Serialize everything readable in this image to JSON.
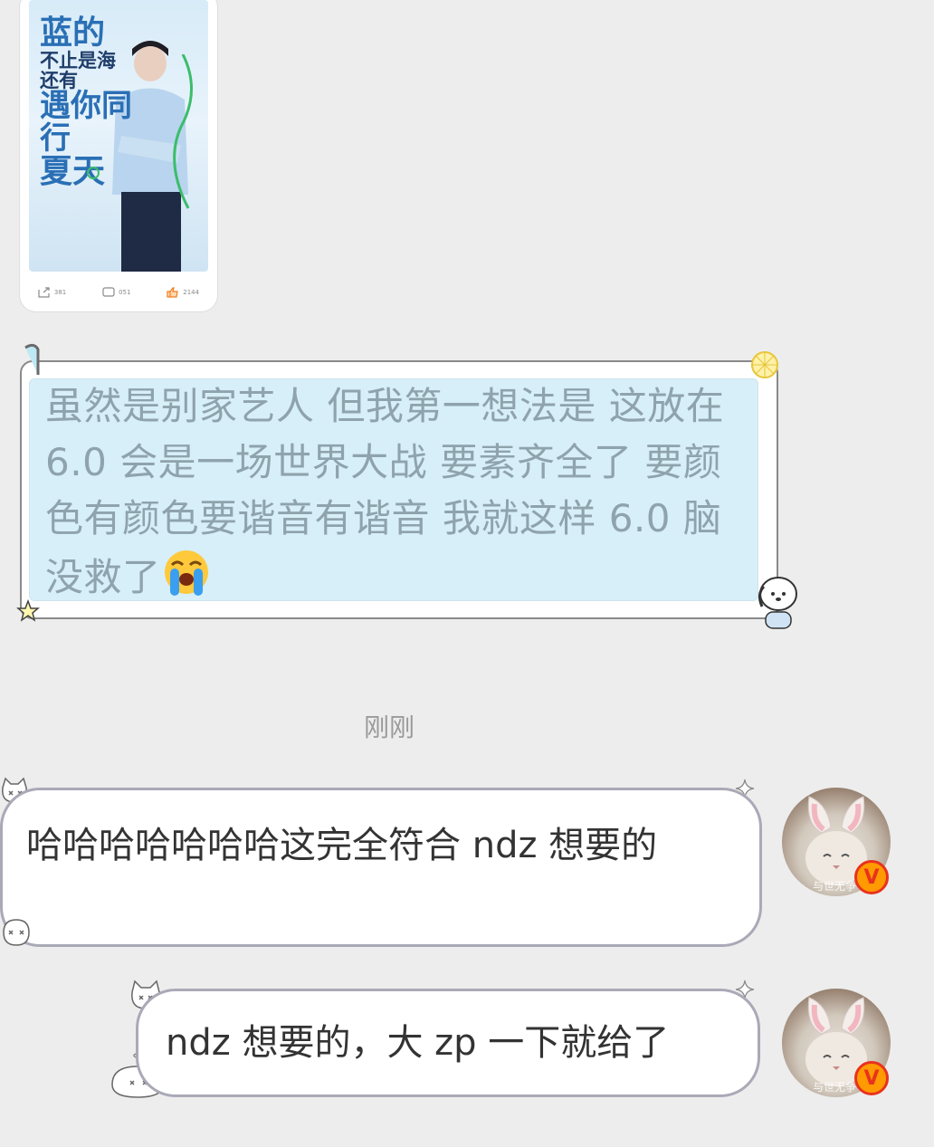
{
  "shared_post": {
    "poster": {
      "line1": "蓝的",
      "line2": "不止是海",
      "line3": "还有",
      "line4": "遇你同行",
      "line5": "夏天"
    },
    "actions": [
      {
        "icon": "share-icon",
        "count": "381"
      },
      {
        "icon": "comment-icon",
        "count": "051"
      },
      {
        "icon": "like-icon",
        "count": "2144"
      }
    ]
  },
  "messages": [
    {
      "text": "虽然是别家艺人 但我第一想法是 这放在 6.0 会是一场世界大战 要素齐全了 要颜色有颜色要谐音有谐音 我就这样 6.0 脑没救了",
      "emoji": "loudly-crying-face"
    },
    {
      "text": "哈哈哈哈哈哈哈这完全符合 ndz 想要的",
      "avatar_caption": "与世无争"
    },
    {
      "text": "ndz 想要的，大 zp 一下就给了",
      "avatar_caption": "与世无争"
    }
  ],
  "timestamp": "刚刚",
  "colors": {
    "background": "#ededed",
    "bubble_border": "#a9a9b7",
    "deco_fill": "#d7eff8",
    "deco_text": "#8fa3ad",
    "verified_badge": "#ff9a00"
  }
}
